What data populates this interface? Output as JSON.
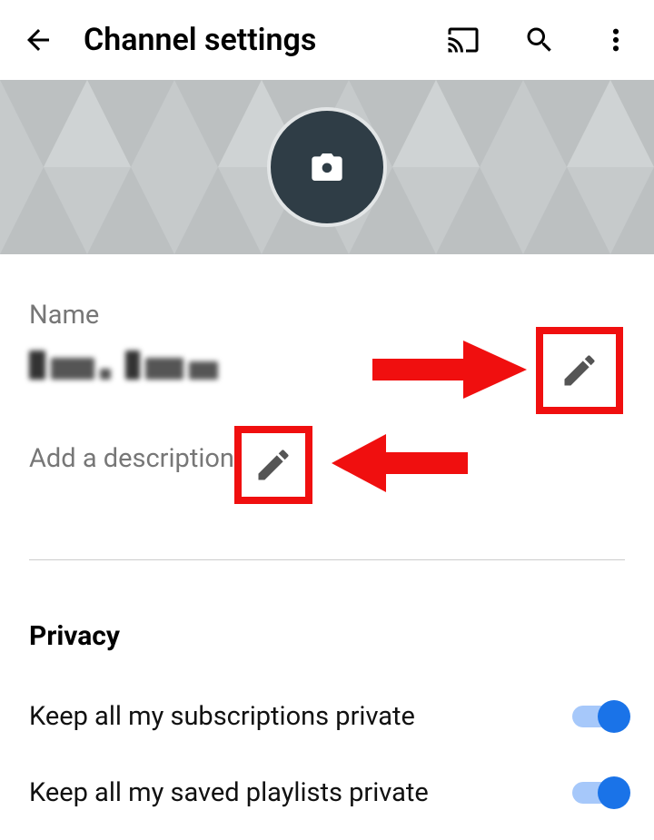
{
  "header": {
    "title": "Channel settings"
  },
  "name": {
    "label": "Name",
    "value": "████ ████"
  },
  "description": {
    "placeholder": "Add a description"
  },
  "privacy": {
    "header": "Privacy",
    "subscriptions_label": "Keep all my subscriptions private",
    "subscriptions_on": true,
    "playlists_label": "Keep all my saved playlists private",
    "playlists_on": true
  }
}
